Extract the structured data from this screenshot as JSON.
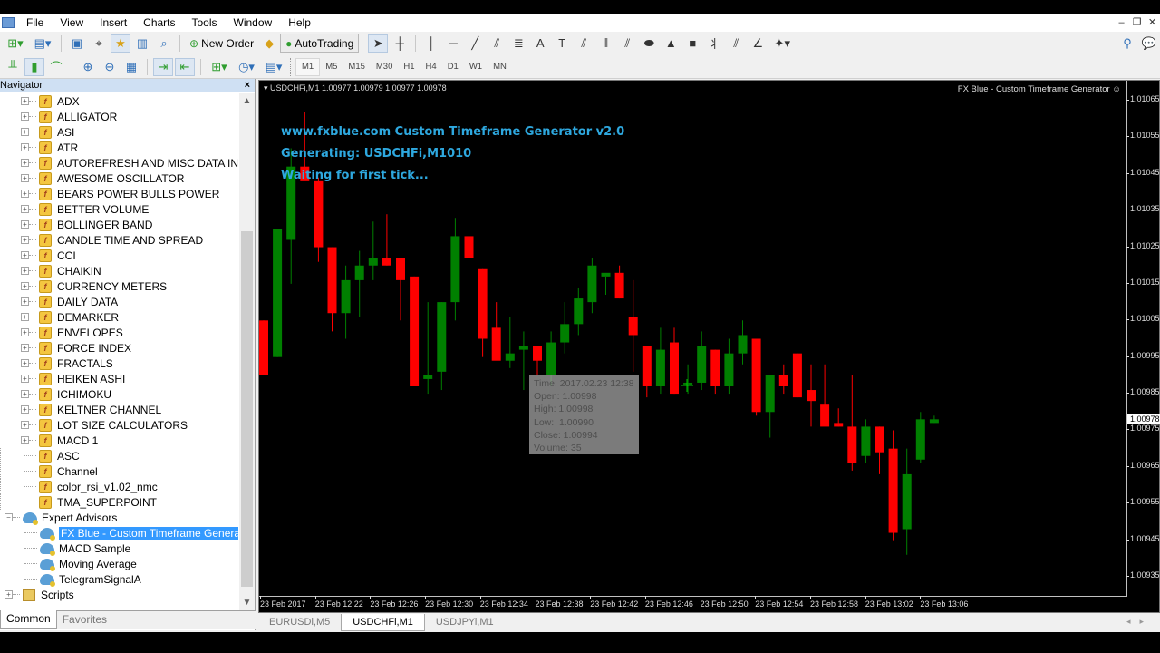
{
  "menu": {
    "items": [
      "File",
      "View",
      "Insert",
      "Charts",
      "Tools",
      "Window",
      "Help"
    ],
    "window_controls": [
      "minimize",
      "restore",
      "close"
    ]
  },
  "toolbar": {
    "new_order_label": "New Order",
    "autotrading_label": "AutoTrading",
    "timeframes": [
      "M1",
      "M5",
      "M15",
      "M30",
      "H1",
      "H4",
      "D1",
      "W1",
      "MN"
    ]
  },
  "navigator": {
    "title": "Navigator",
    "close_glyph": "×",
    "indicators": [
      {
        "label": "ADX",
        "expandable": true
      },
      {
        "label": "ALLIGATOR",
        "expandable": true
      },
      {
        "label": "ASI",
        "expandable": true
      },
      {
        "label": "ATR",
        "expandable": true
      },
      {
        "label": "AUTOREFRESH AND MISC DATA INDICA",
        "expandable": true
      },
      {
        "label": "AWESOME OSCILLATOR",
        "expandable": true
      },
      {
        "label": "BEARS POWER BULLS POWER",
        "expandable": true
      },
      {
        "label": "BETTER VOLUME",
        "expandable": true
      },
      {
        "label": "BOLLINGER BAND",
        "expandable": true
      },
      {
        "label": "CANDLE TIME AND SPREAD",
        "expandable": true
      },
      {
        "label": "CCI",
        "expandable": true
      },
      {
        "label": "CHAIKIN",
        "expandable": true
      },
      {
        "label": "CURRENCY METERS",
        "expandable": true
      },
      {
        "label": "DAILY DATA",
        "expandable": true
      },
      {
        "label": "DEMARKER",
        "expandable": true
      },
      {
        "label": "ENVELOPES",
        "expandable": true
      },
      {
        "label": "FORCE INDEX",
        "expandable": true
      },
      {
        "label": "FRACTALS",
        "expandable": true
      },
      {
        "label": "HEIKEN ASHI",
        "expandable": true
      },
      {
        "label": "ICHIMOKU",
        "expandable": true
      },
      {
        "label": "KELTNER CHANNEL",
        "expandable": true
      },
      {
        "label": "LOT SIZE CALCULATORS",
        "expandable": true
      },
      {
        "label": "MACD 1",
        "expandable": true
      },
      {
        "label": "ASC",
        "expandable": false
      },
      {
        "label": "Channel",
        "expandable": false
      },
      {
        "label": "color_rsi_v1.02_nmc",
        "expandable": false
      },
      {
        "label": "TMA_SUPERPOINT",
        "expandable": false
      }
    ],
    "expert_advisors": {
      "label": "Expert Advisors",
      "items": [
        {
          "label": "FX Blue - Custom Timeframe Generator",
          "selected": true
        },
        {
          "label": "MACD Sample",
          "selected": false
        },
        {
          "label": "Moving Average",
          "selected": false
        },
        {
          "label": "TelegramSignalA",
          "selected": false
        }
      ]
    },
    "scripts_label": "Scripts",
    "tabs": [
      {
        "label": "Common",
        "active": true
      },
      {
        "label": "Favorites",
        "active": false
      }
    ]
  },
  "chart": {
    "header": "USDCHFi,M1  1.00977 1.00979 1.00977 1.00978",
    "ea_name": "FX Blue - Custom Timeframe Generator",
    "ea_smiley": "☺",
    "ea_lines": [
      "www.fxblue.com Custom Timeframe Generator v2.0",
      "Generating: USDCHFi,M1010",
      "Waiting for first tick..."
    ],
    "ea_text_color": "#2ea8df",
    "tooltip": [
      "Time: 2017.02.23 12:38",
      "Open: 1.00998",
      "High: 1.00998",
      "Low:  1.00990",
      "Close: 1.00994",
      "Volume: 35"
    ],
    "last_price": "1.00978",
    "bull_color": "#008000",
    "bear_color": "#ff0000",
    "tabs": [
      {
        "label": "EURUSDi,M5",
        "active": false
      },
      {
        "label": "USDCHFi,M1",
        "active": true
      },
      {
        "label": "USDJPYi,M1",
        "active": false
      }
    ]
  },
  "chart_data": {
    "type": "candlestick",
    "symbol": "USDCHFi",
    "timeframe": "M1",
    "ylim": [
      1.0093,
      1.0107
    ],
    "y_ticks": [
      "1.01065",
      "1.01055",
      "1.01045",
      "1.01035",
      "1.01025",
      "1.01015",
      "1.01005",
      "1.00995",
      "1.00985",
      "1.00975",
      "1.00965",
      "1.00955",
      "1.00945",
      "1.00935"
    ],
    "x_ticks": [
      "23 Feb 2017",
      "23 Feb 12:22",
      "23 Feb 12:26",
      "23 Feb 12:30",
      "23 Feb 12:34",
      "23 Feb 12:38",
      "23 Feb 12:42",
      "23 Feb 12:46",
      "23 Feb 12:50",
      "23 Feb 12:54",
      "23 Feb 12:58",
      "23 Feb 13:02",
      "23 Feb 13:06"
    ],
    "candles": [
      {
        "o": 1.01005,
        "h": 1.01005,
        "l": 1.0099,
        "c": 1.0099
      },
      {
        "o": 1.00995,
        "h": 1.0103,
        "l": 1.00995,
        "c": 1.0103
      },
      {
        "o": 1.01027,
        "h": 1.01052,
        "l": 1.01015,
        "c": 1.01047
      },
      {
        "o": 1.01047,
        "h": 1.01062,
        "l": 1.01044,
        "c": 1.01043
      },
      {
        "o": 1.01043,
        "h": 1.01044,
        "l": 1.01021,
        "c": 1.01025
      },
      {
        "o": 1.01025,
        "h": 1.01025,
        "l": 1.01002,
        "c": 1.01007
      },
      {
        "o": 1.01007,
        "h": 1.0102,
        "l": 1.01,
        "c": 1.01016
      },
      {
        "o": 1.01016,
        "h": 1.01024,
        "l": 1.01006,
        "c": 1.0102
      },
      {
        "o": 1.0102,
        "h": 1.01032,
        "l": 1.01016,
        "c": 1.01022
      },
      {
        "o": 1.01022,
        "h": 1.01034,
        "l": 1.0102,
        "c": 1.0102
      },
      {
        "o": 1.01022,
        "h": 1.01022,
        "l": 1.01005,
        "c": 1.01016
      },
      {
        "o": 1.01017,
        "h": 1.01017,
        "l": 1.00987,
        "c": 1.00987
      },
      {
        "o": 1.00989,
        "h": 1.0101,
        "l": 1.00985,
        "c": 1.0099
      },
      {
        "o": 1.00991,
        "h": 1.0101,
        "l": 1.00986,
        "c": 1.0101
      },
      {
        "o": 1.0101,
        "h": 1.01033,
        "l": 1.01005,
        "c": 1.01028
      },
      {
        "o": 1.01028,
        "h": 1.0103,
        "l": 1.01015,
        "c": 1.01022
      },
      {
        "o": 1.01019,
        "h": 1.01019,
        "l": 1.00995,
        "c": 1.01
      },
      {
        "o": 1.01003,
        "h": 1.0101,
        "l": 1.00995,
        "c": 1.00994
      },
      {
        "o": 1.00994,
        "h": 1.01006,
        "l": 1.00992,
        "c": 1.00996
      },
      {
        "o": 1.00997,
        "h": 1.01002,
        "l": 1.00986,
        "c": 1.00998
      },
      {
        "o": 1.00998,
        "h": 1.00998,
        "l": 1.0099,
        "c": 1.00994
      },
      {
        "o": 1.0099,
        "h": 1.01002,
        "l": 1.00987,
        "c": 1.00999
      },
      {
        "o": 1.00999,
        "h": 1.0101,
        "l": 1.00996,
        "c": 1.01004
      },
      {
        "o": 1.01004,
        "h": 1.01014,
        "l": 1.01001,
        "c": 1.01011
      },
      {
        "o": 1.0101,
        "h": 1.01022,
        "l": 1.01007,
        "c": 1.0102
      },
      {
        "o": 1.01017,
        "h": 1.01017,
        "l": 1.01012,
        "c": 1.01018
      },
      {
        "o": 1.01018,
        "h": 1.0102,
        "l": 1.01011,
        "c": 1.01011
      },
      {
        "o": 1.01006,
        "h": 1.01016,
        "l": 1.00991,
        "c": 1.01001
      },
      {
        "o": 1.00998,
        "h": 1.00998,
        "l": 1.00984,
        "c": 1.00987
      },
      {
        "o": 1.00987,
        "h": 1.01003,
        "l": 1.00985,
        "c": 1.00997
      },
      {
        "o": 1.00999,
        "h": 1.01003,
        "l": 1.00985,
        "c": 1.00985
      },
      {
        "o": 1.00988,
        "h": 1.00993,
        "l": 1.00985,
        "c": 1.00988
      },
      {
        "o": 1.00988,
        "h": 1.01002,
        "l": 1.00986,
        "c": 1.00998
      },
      {
        "o": 1.00997,
        "h": 1.00997,
        "l": 1.00985,
        "c": 1.00987
      },
      {
        "o": 1.00987,
        "h": 1.01,
        "l": 1.00985,
        "c": 1.00996
      },
      {
        "o": 1.00996,
        "h": 1.01005,
        "l": 1.00993,
        "c": 1.01001
      },
      {
        "o": 1.01,
        "h": 1.01,
        "l": 1.00979,
        "c": 1.0098
      },
      {
        "o": 1.0098,
        "h": 1.0099,
        "l": 1.00973,
        "c": 1.0099
      },
      {
        "o": 1.0099,
        "h": 1.00993,
        "l": 1.00985,
        "c": 1.00987
      },
      {
        "o": 1.00996,
        "h": 1.00996,
        "l": 1.00984,
        "c": 1.00984
      },
      {
        "o": 1.00986,
        "h": 1.00993,
        "l": 1.00976,
        "c": 1.00983
      },
      {
        "o": 1.00982,
        "h": 1.00993,
        "l": 1.00979,
        "c": 1.00976
      },
      {
        "o": 1.00977,
        "h": 1.00981,
        "l": 1.00976,
        "c": 1.00976
      },
      {
        "o": 1.00976,
        "h": 1.0099,
        "l": 1.00964,
        "c": 1.00966
      },
      {
        "o": 1.00968,
        "h": 1.00978,
        "l": 1.00966,
        "c": 1.00976
      },
      {
        "o": 1.00976,
        "h": 1.00976,
        "l": 1.00963,
        "c": 1.00969
      },
      {
        "o": 1.0097,
        "h": 1.00975,
        "l": 1.00945,
        "c": 1.00947
      },
      {
        "o": 1.00948,
        "h": 1.0097,
        "l": 1.00941,
        "c": 1.00963
      },
      {
        "o": 1.00967,
        "h": 1.0098,
        "l": 1.00966,
        "c": 1.00978
      },
      {
        "o": 1.00977,
        "h": 1.00979,
        "l": 1.00977,
        "c": 1.00978
      }
    ]
  }
}
